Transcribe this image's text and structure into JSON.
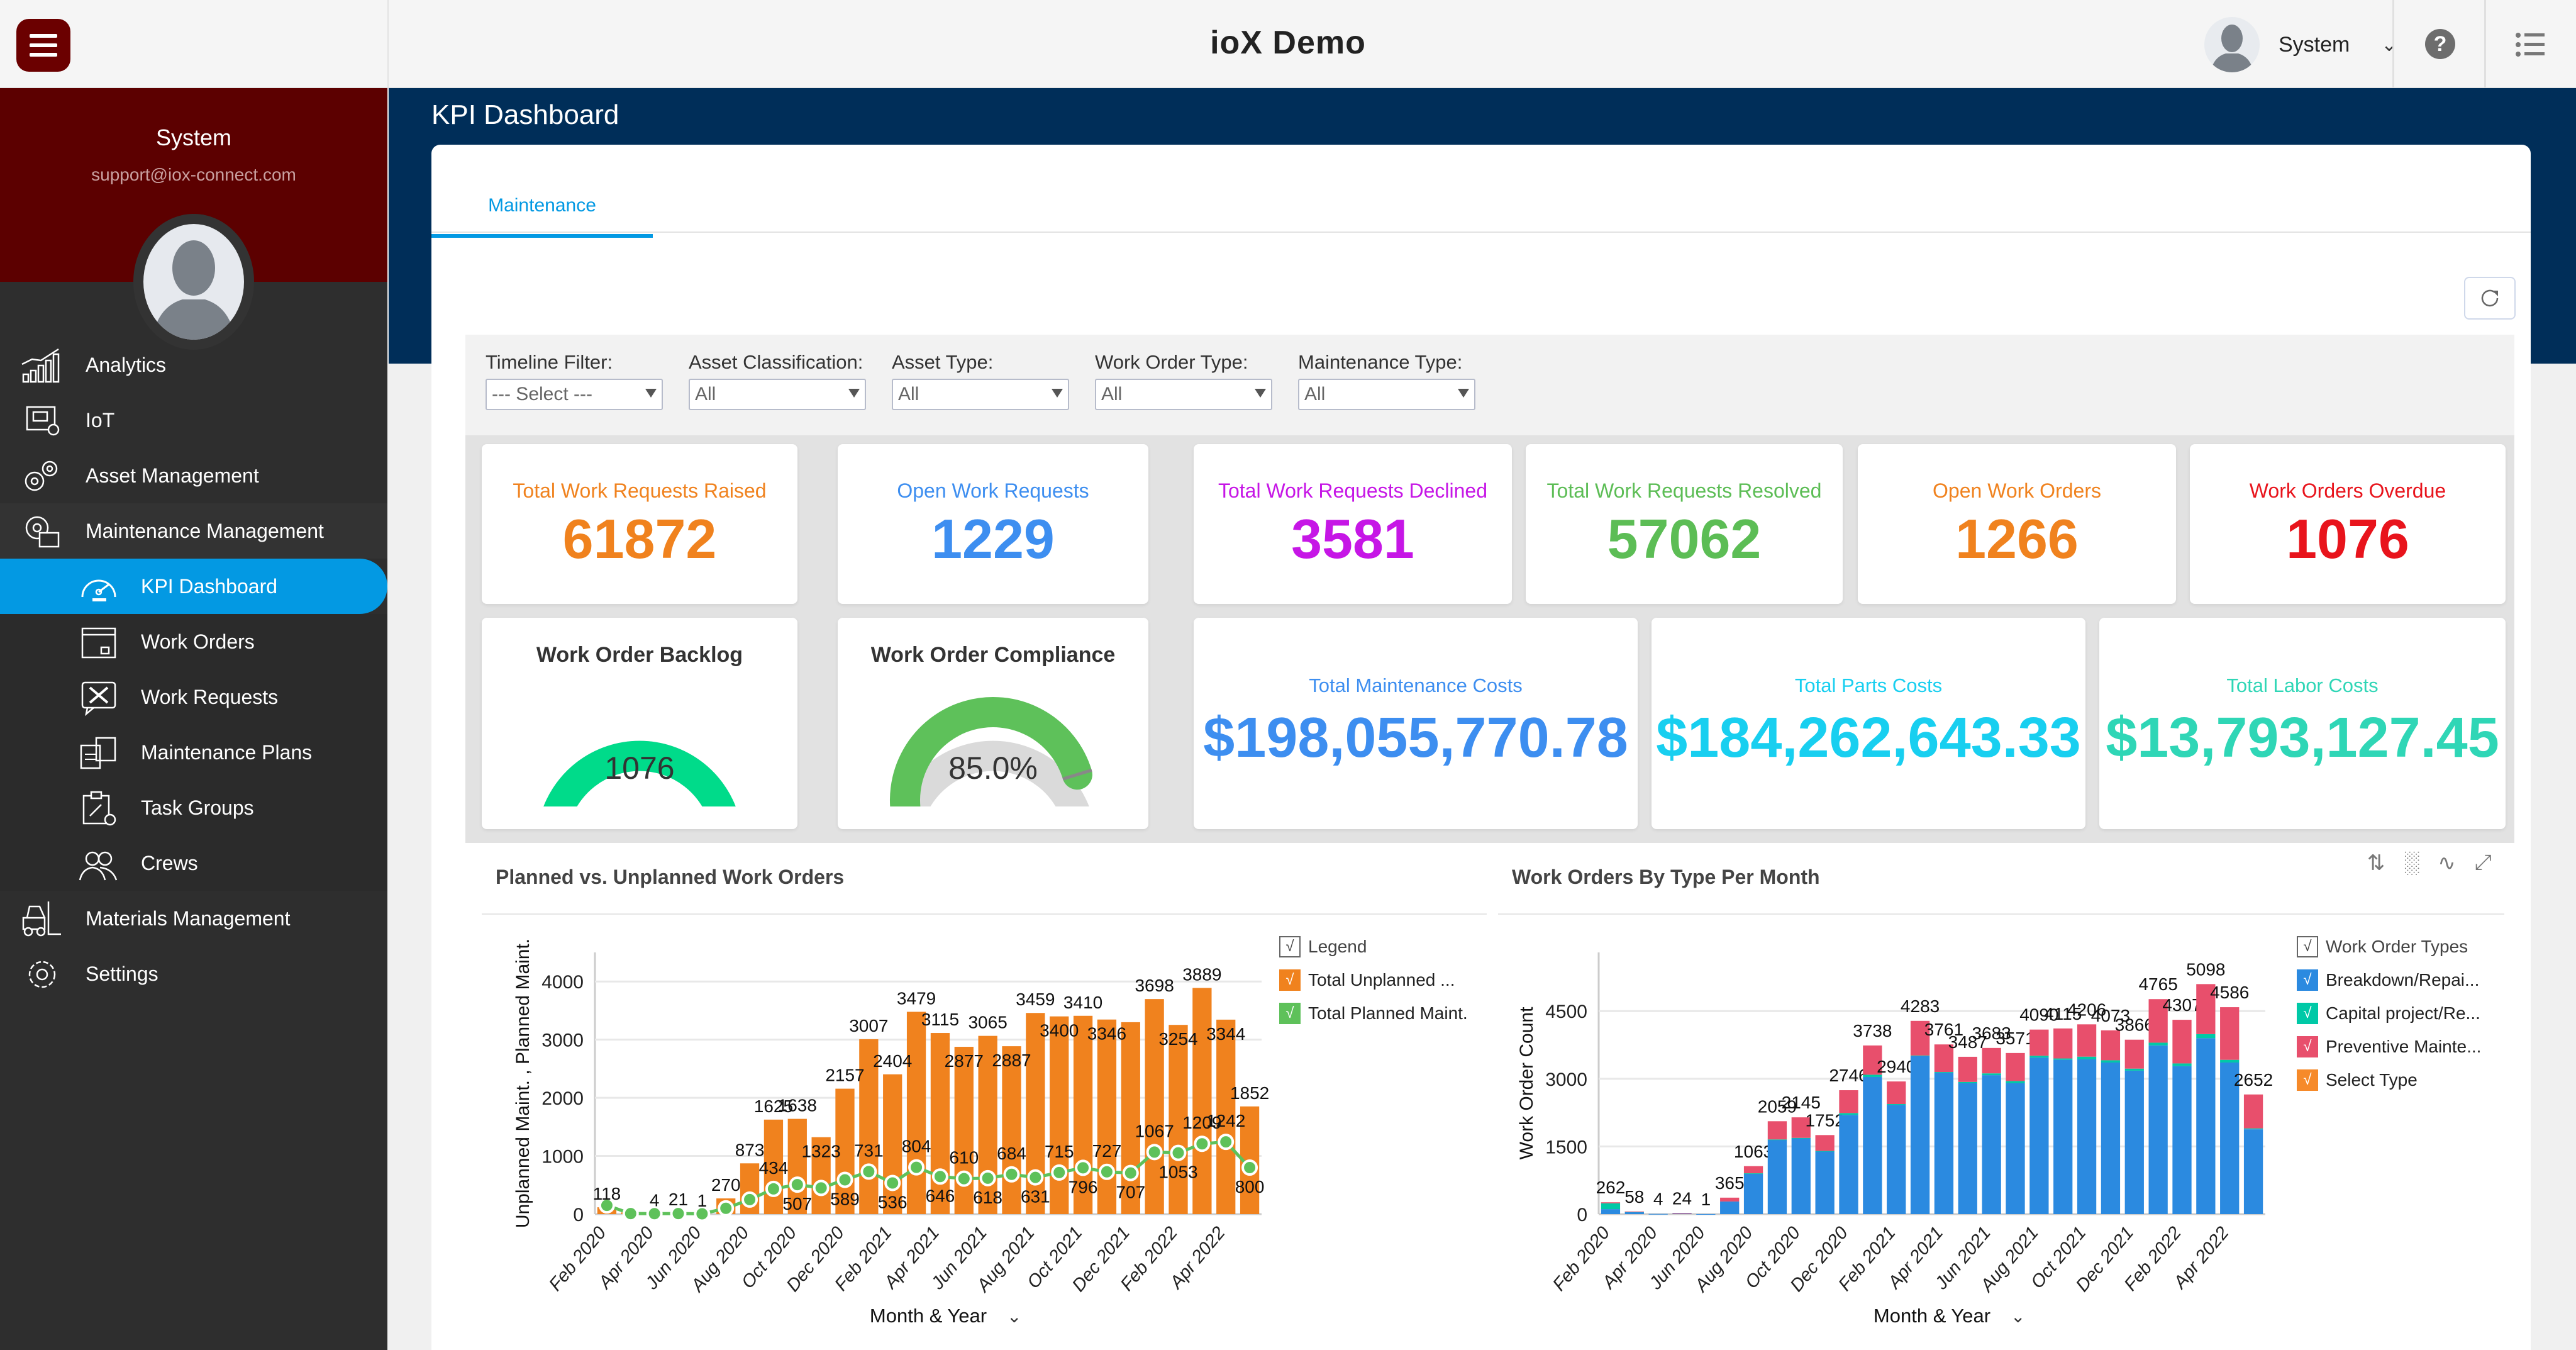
{
  "app": {
    "title": "ioX Demo"
  },
  "topbar": {
    "user_name": "System",
    "help_icon": "question-circle-icon",
    "menu_icon": "list-icon"
  },
  "sidebar": {
    "profile_name": "System",
    "profile_email": "support@iox-connect.com",
    "items": [
      {
        "label": "Analytics",
        "icon": "analytics-chart-icon"
      },
      {
        "label": "IoT",
        "icon": "iot-chip-icon"
      },
      {
        "label": "Asset Management",
        "icon": "gears-icon"
      },
      {
        "label": "Maintenance Management",
        "icon": "maintenance-gear-icon"
      },
      {
        "label": "KPI Dashboard",
        "icon": "speedometer-icon",
        "active": true
      },
      {
        "label": "Work Orders",
        "icon": "calendar-icon"
      },
      {
        "label": "Work Requests",
        "icon": "tools-chat-icon"
      },
      {
        "label": "Maintenance Plans",
        "icon": "documents-icon"
      },
      {
        "label": "Task Groups",
        "icon": "clipboard-gear-icon"
      },
      {
        "label": "Crews",
        "icon": "crew-helmets-icon"
      },
      {
        "label": "Materials Management",
        "icon": "forklift-icon"
      },
      {
        "label": "Settings",
        "icon": "settings-gear-icon"
      }
    ]
  },
  "page": {
    "title": "KPI Dashboard",
    "tabs": [
      {
        "label": "Maintenance",
        "active": true
      }
    ]
  },
  "filters": [
    {
      "label": "Timeline Filter:",
      "value": "--- Select ---"
    },
    {
      "label": "Asset Classification:",
      "value": "All"
    },
    {
      "label": "Asset Type:",
      "value": "All"
    },
    {
      "label": "Work Order Type:",
      "value": "All"
    },
    {
      "label": "Maintenance Type:",
      "value": "All"
    }
  ],
  "kpis": [
    {
      "title": "Total Work Requests Raised",
      "value": "61872",
      "color": "#f0821e"
    },
    {
      "title": "Open Work Requests",
      "value": "1229",
      "color": "#3d8ef0"
    },
    {
      "title": "Total Work Requests Declined",
      "value": "3581",
      "color": "#c616e6"
    },
    {
      "title": "Total Work Requests Resolved",
      "value": "57062",
      "color": "#5cbd55"
    },
    {
      "title": "Open Work Orders",
      "value": "1266",
      "color": "#f0821e"
    },
    {
      "title": "Work Orders Overdue",
      "value": "1076",
      "color": "#e8141c"
    }
  ],
  "gauges": [
    {
      "title": "Work Order Backlog",
      "value": "1076",
      "fill": 1.0,
      "color": "#00db8a"
    },
    {
      "title": "Work Order Compliance",
      "value": "85.0%",
      "fill": 0.85,
      "color": "#5ec15a"
    }
  ],
  "costs": [
    {
      "title": "Total Maintenance Costs",
      "value": "$198,055,770.78",
      "color": "#3d8ef0"
    },
    {
      "title": "Total Parts Costs",
      "value": "$184,262,643.33",
      "color": "#18cff0"
    },
    {
      "title": "Total Labor Costs",
      "value": "$13,793,127.45",
      "color": "#2fd6b6"
    }
  ],
  "chart_data": [
    {
      "type": "bar",
      "title": "Planned vs. Unplanned Work Orders",
      "xlabel": "Month & Year",
      "ylabel": "Unplanned Maint. , Planned Maint.",
      "ylim": [
        0,
        4500
      ],
      "yticks": [
        0,
        1000,
        2000,
        3000,
        4000
      ],
      "grid": true,
      "legend_position": "right",
      "legend_title": "Legend",
      "x": [
        "Feb 2020",
        "Mar 2020",
        "Apr 2020",
        "May 2020",
        "Jun 2020",
        "Jul 2020",
        "Aug 2020",
        "Sep 2020",
        "Oct 2020",
        "Nov 2020",
        "Dec 2020",
        "Jan 2021",
        "Feb 2021",
        "Mar 2021",
        "Apr 2021",
        "May 2021",
        "Jun 2021",
        "Jul 2021",
        "Aug 2021",
        "Sep 2021",
        "Oct 2021",
        "Nov 2021",
        "Dec 2021",
        "Jan 2022",
        "Feb 2022",
        "Mar 2022",
        "Apr 2022",
        "May 2022"
      ],
      "xtick_labels": [
        "Feb 2020",
        "Apr 2020",
        "Jun 2020",
        "Aug 2020",
        "Oct 2020",
        "Dec 2020",
        "Feb 2021",
        "Apr 2021",
        "Jun 2021",
        "Aug 2021",
        "Oct 2021",
        "Dec 2021",
        "Feb 2022",
        "Apr 2022"
      ],
      "series": [
        {
          "name": "Total Unplanned ...",
          "kind": "bar",
          "color": "#f0821e",
          "values": [
            118,
            30,
            4,
            21,
            1,
            270,
            873,
            1625,
            1638,
            1323,
            2157,
            3007,
            2404,
            3479,
            3115,
            2877,
            3065,
            2887,
            3459,
            3400,
            3410,
            3346,
            3300,
            3698,
            3254,
            3889,
            3344,
            1852
          ]
        },
        {
          "name": "Total Planned Maint.",
          "kind": "line",
          "color": "#5ec15a",
          "values": [
            150,
            10,
            8,
            10,
            5,
            100,
            250,
            434,
            507,
            450,
            589,
            731,
            536,
            804,
            646,
            610,
            618,
            684,
            631,
            715,
            796,
            727,
            707,
            1067,
            1053,
            1209,
            1242,
            800
          ]
        }
      ],
      "data_labels": [
        {
          "series": 0,
          "i": 0,
          "text": "118"
        },
        {
          "series": 0,
          "i": 2,
          "text": "4"
        },
        {
          "series": 0,
          "i": 3,
          "text": "21"
        },
        {
          "series": 0,
          "i": 4,
          "text": "1"
        },
        {
          "series": 0,
          "i": 5,
          "text": "270"
        },
        {
          "series": 0,
          "i": 6,
          "text": "873"
        },
        {
          "series": 0,
          "i": 7,
          "text": "1625"
        },
        {
          "series": 0,
          "i": 8,
          "text": "1638"
        },
        {
          "series": 0,
          "i": 9,
          "text": "1323"
        },
        {
          "series": 0,
          "i": 10,
          "text": "2157"
        },
        {
          "series": 0,
          "i": 11,
          "text": "3007"
        },
        {
          "series": 0,
          "i": 12,
          "text": "2404"
        },
        {
          "series": 0,
          "i": 13,
          "text": "3479"
        },
        {
          "series": 0,
          "i": 14,
          "text": "3115"
        },
        {
          "series": 0,
          "i": 15,
          "text": "2877"
        },
        {
          "series": 0,
          "i": 16,
          "text": "3065"
        },
        {
          "series": 0,
          "i": 17,
          "text": "2887"
        },
        {
          "series": 0,
          "i": 18,
          "text": "3459"
        },
        {
          "series": 0,
          "i": 19,
          "text": "3400"
        },
        {
          "series": 0,
          "i": 20,
          "text": "3410"
        },
        {
          "series": 0,
          "i": 21,
          "text": "3346"
        },
        {
          "series": 0,
          "i": 23,
          "text": "3698"
        },
        {
          "series": 0,
          "i": 24,
          "text": "3254"
        },
        {
          "series": 0,
          "i": 25,
          "text": "3889"
        },
        {
          "series": 0,
          "i": 26,
          "text": "3344"
        },
        {
          "series": 0,
          "i": 27,
          "text": "1852"
        },
        {
          "series": 1,
          "i": 7,
          "text": "434"
        },
        {
          "series": 1,
          "i": 8,
          "text": "507"
        },
        {
          "series": 1,
          "i": 10,
          "text": "589"
        },
        {
          "series": 1,
          "i": 11,
          "text": "731"
        },
        {
          "series": 1,
          "i": 12,
          "text": "536"
        },
        {
          "series": 1,
          "i": 13,
          "text": "804"
        },
        {
          "series": 1,
          "i": 14,
          "text": "646"
        },
        {
          "series": 1,
          "i": 15,
          "text": "610"
        },
        {
          "series": 1,
          "i": 16,
          "text": "618"
        },
        {
          "series": 1,
          "i": 17,
          "text": "684"
        },
        {
          "series": 1,
          "i": 18,
          "text": "631"
        },
        {
          "series": 1,
          "i": 19,
          "text": "715"
        },
        {
          "series": 1,
          "i": 20,
          "text": "796"
        },
        {
          "series": 1,
          "i": 21,
          "text": "727"
        },
        {
          "series": 1,
          "i": 22,
          "text": "707"
        },
        {
          "series": 1,
          "i": 23,
          "text": "1067"
        },
        {
          "series": 1,
          "i": 24,
          "text": "1053"
        },
        {
          "series": 1,
          "i": 25,
          "text": "1209"
        },
        {
          "series": 1,
          "i": 26,
          "text": "1242"
        },
        {
          "series": 1,
          "i": 27,
          "text": "800"
        }
      ]
    },
    {
      "type": "bar",
      "stacked": true,
      "title": "Work Orders By Type Per Month",
      "xlabel": "Month & Year",
      "ylabel": "Work Order Count",
      "ylim": [
        0,
        5800
      ],
      "yticks": [
        0,
        1500,
        3000,
        4500
      ],
      "grid": true,
      "legend_position": "right",
      "legend_title": "Work Order Types",
      "x": [
        "Feb 2020",
        "Mar 2020",
        "Apr 2020",
        "May 2020",
        "Jun 2020",
        "Jul 2020",
        "Aug 2020",
        "Sep 2020",
        "Oct 2020",
        "Nov 2020",
        "Dec 2020",
        "Jan 2021",
        "Feb 2021",
        "Mar 2021",
        "Apr 2021",
        "May 2021",
        "Jun 2021",
        "Jul 2021",
        "Aug 2021",
        "Sep 2021",
        "Oct 2021",
        "Nov 2021",
        "Dec 2021",
        "Jan 2022",
        "Feb 2022",
        "Mar 2022",
        "Apr 2022",
        "May 2022"
      ],
      "xtick_labels": [
        "Feb 2020",
        "Apr 2020",
        "Jun 2020",
        "Aug 2020",
        "Oct 2020",
        "Dec 2020",
        "Feb 2021",
        "Apr 2021",
        "Jun 2021",
        "Aug 2021",
        "Oct 2021",
        "Dec 2021",
        "Feb 2022",
        "Apr 2022"
      ],
      "totals": [
        262,
        58,
        4,
        24,
        1,
        365,
        1063,
        2059,
        2145,
        1752,
        2746,
        3738,
        2940,
        4283,
        3761,
        3487,
        3683,
        3571,
        4090,
        4115,
        4206,
        4073,
        3866,
        4765,
        4307,
        5098,
        4586,
        2652
      ],
      "series": [
        {
          "name": "Breakdown/Repai...",
          "color": "#2b8ae0",
          "values": [
            110,
            50,
            4,
            22,
            1,
            280,
            900,
            1650,
            1680,
            1390,
            2200,
            3040,
            2420,
            3500,
            3130,
            2900,
            3080,
            2900,
            3470,
            3420,
            3430,
            3360,
            3180,
            3740,
            3280,
            3900,
            3360,
            1880
          ]
        },
        {
          "name": "Capital project/Re...",
          "color": "#00c9a7",
          "values": [
            130,
            4,
            0,
            0,
            0,
            0,
            5,
            5,
            10,
            10,
            40,
            50,
            20,
            15,
            20,
            30,
            40,
            50,
            40,
            30,
            60,
            50,
            45,
            60,
            60,
            90,
            60,
            20
          ]
        },
        {
          "name": "Preventive Mainte...",
          "color": "#e84f6c",
          "values": [
            22,
            4,
            0,
            2,
            0,
            85,
            158,
            404,
            455,
            352,
            506,
            648,
            500,
            768,
            611,
            557,
            563,
            621,
            580,
            665,
            716,
            663,
            641,
            965,
            967,
            1108,
            1166,
            752
          ]
        },
        {
          "name": "Select Type",
          "color": "#f68a2a",
          "values": [
            0,
            0,
            0,
            0,
            0,
            0,
            0,
            0,
            0,
            0,
            0,
            0,
            0,
            0,
            0,
            0,
            0,
            0,
            0,
            0,
            0,
            0,
            0,
            0,
            0,
            0,
            0,
            0
          ]
        }
      ]
    }
  ],
  "chart_toolbar": [
    "sort-icon",
    "bar-chart-icon",
    "chart-type-icon",
    "expand-icon"
  ]
}
